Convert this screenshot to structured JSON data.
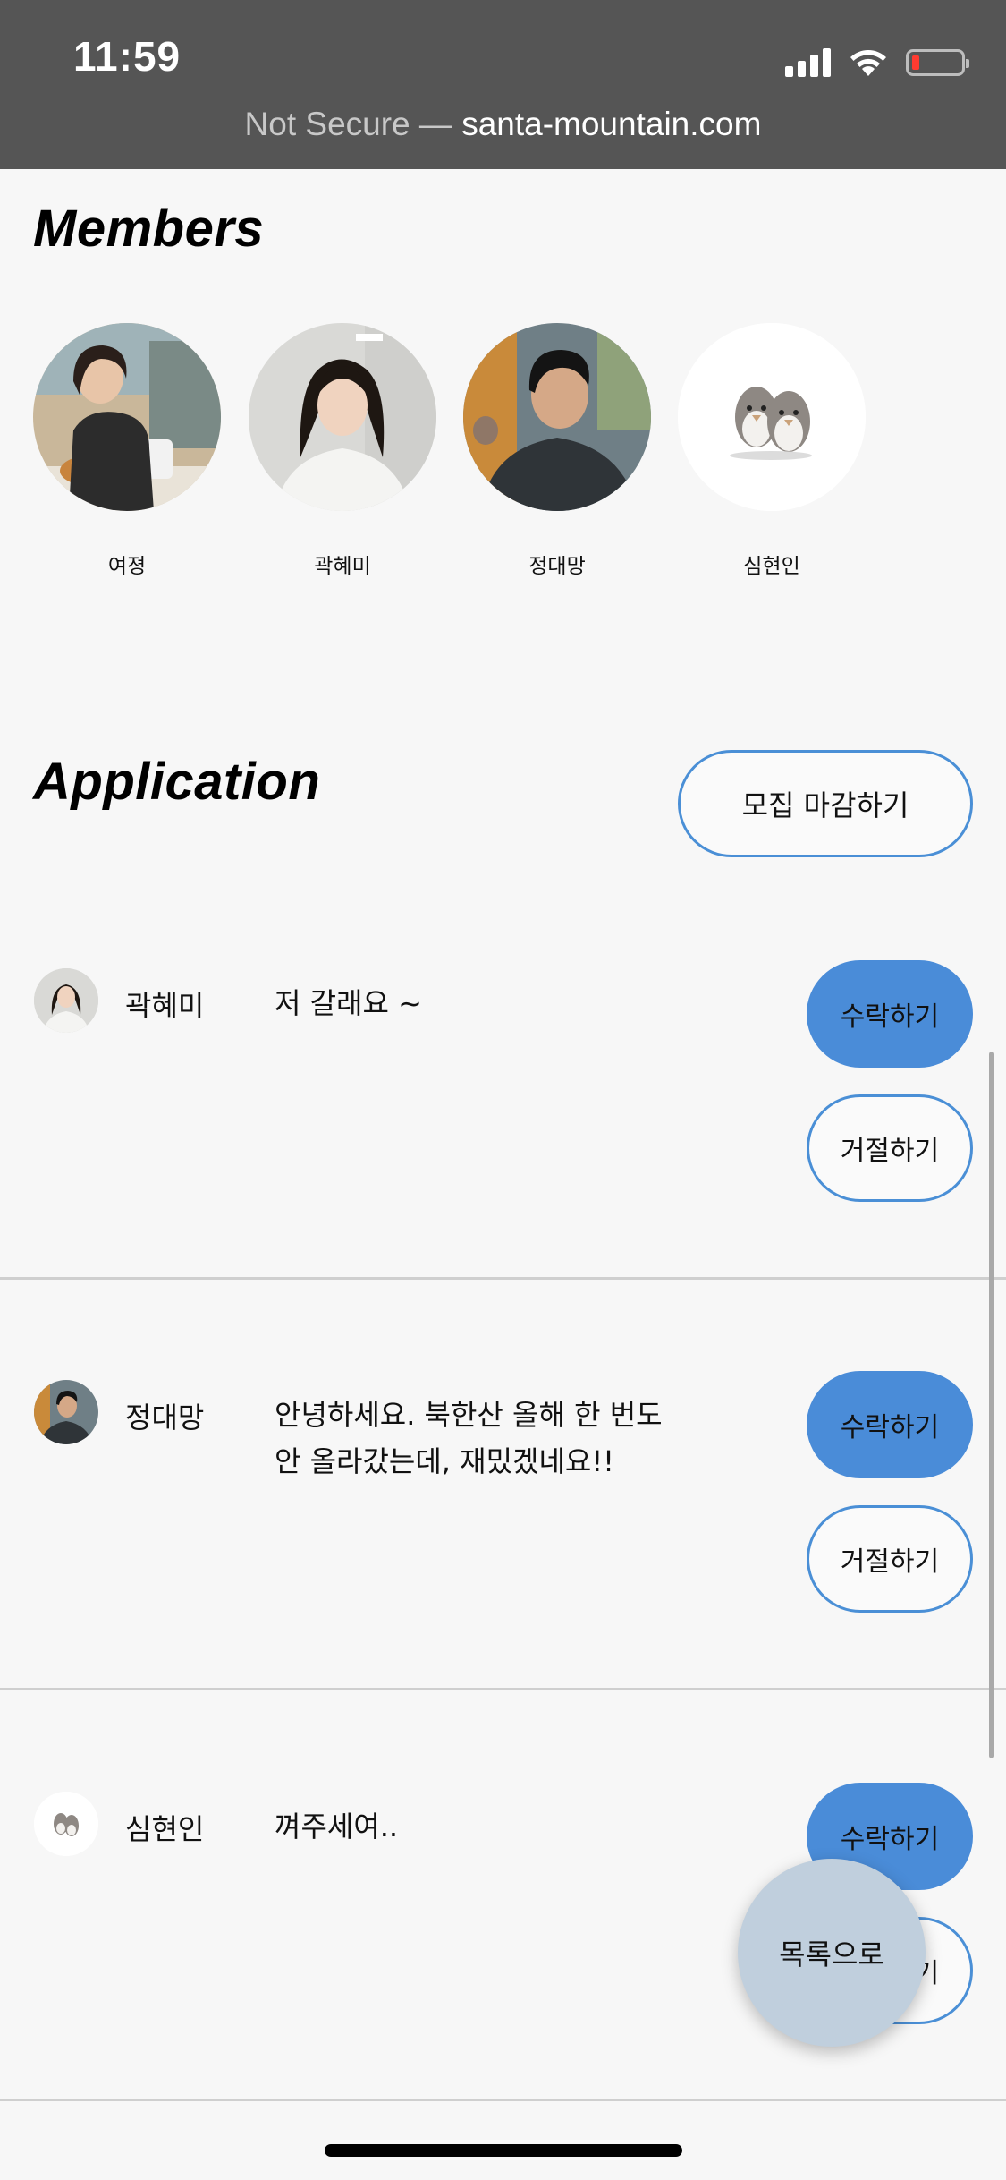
{
  "status_bar": {
    "time": "11:59"
  },
  "browser": {
    "not_secure": "Not Secure —",
    "domain": "santa-mountain.com"
  },
  "members": {
    "heading": "Members",
    "items": [
      {
        "name": "여졍"
      },
      {
        "name": "곽혜미"
      },
      {
        "name": "정대망"
      },
      {
        "name": "심현인"
      }
    ]
  },
  "application": {
    "heading": "Application",
    "close_recruit_label": "모집 마감하기",
    "accept_label": "수락하기",
    "reject_label": "거절하기",
    "items": [
      {
        "name": "곽혜미",
        "message_line1": "저 갈래요 ~",
        "message_line2": ""
      },
      {
        "name": "정대망",
        "message_line1": "안녕하세요. 북한산 올해 한 번도",
        "message_line2": "안 올라갔는데, 재밌겠네요!!"
      },
      {
        "name": "심현인",
        "message_line1": "껴주세여..",
        "message_line2": ""
      }
    ]
  },
  "fab": {
    "label": "목록으로"
  },
  "colors": {
    "accent": "#4a8cd8",
    "topbar": "#555555",
    "fab": "#c0cfdd",
    "background": "#f7f7f7"
  }
}
